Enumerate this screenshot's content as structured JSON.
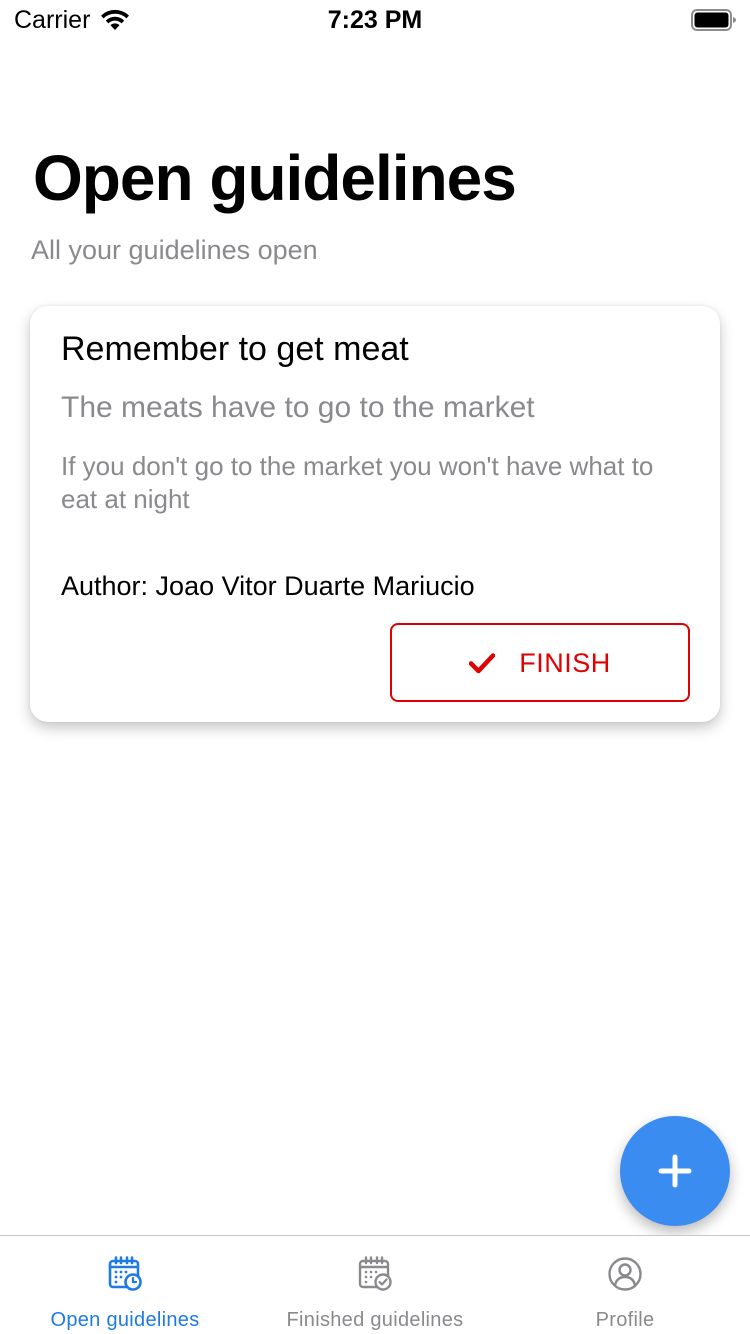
{
  "status_bar": {
    "carrier": "Carrier",
    "time": "7:23 PM",
    "wifi_icon": "wifi-icon",
    "battery_icon": "battery-full-icon"
  },
  "header": {
    "title": "Open guidelines",
    "subtitle": "All your guidelines open"
  },
  "guidelines": [
    {
      "title": "Remember to get meat",
      "description": "The meats have to go to the market",
      "details": "If you don't go to the market you won't have what to eat at night",
      "author": "Author: Joao Vitor Duarte Mariucio",
      "finish_label": "FINISH",
      "finish_icon": "checkmark-icon"
    }
  ],
  "fab": {
    "icon": "plus-icon"
  },
  "tab_bar": {
    "tabs": [
      {
        "label": "Open guidelines",
        "icon": "calendar-clock-icon",
        "active": true
      },
      {
        "label": "Finished guidelines",
        "icon": "calendar-check-icon",
        "active": false
      },
      {
        "label": "Profile",
        "icon": "user-circle-icon",
        "active": false
      }
    ]
  },
  "colors": {
    "accent_blue": "#3b8cf0",
    "active_tab": "#1e7be3",
    "finish_red": "#e00000",
    "muted_text": "#8a8a8e"
  }
}
